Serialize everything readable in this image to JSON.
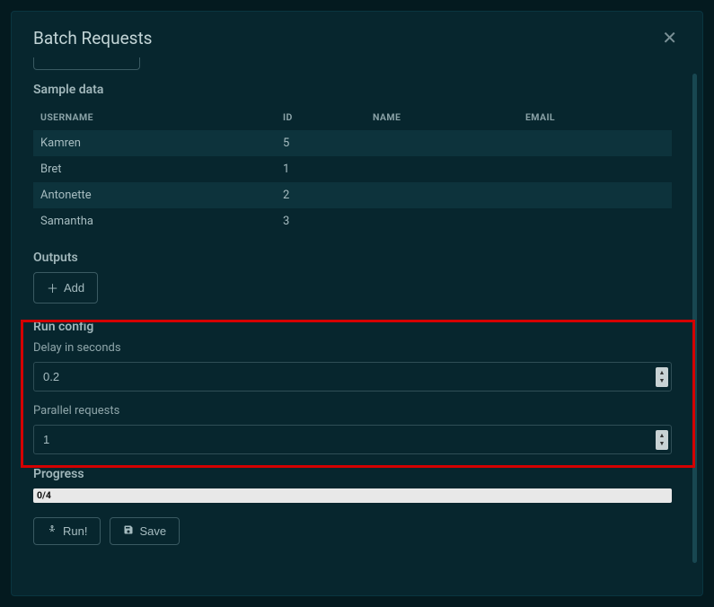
{
  "modal": {
    "title": "Batch Requests"
  },
  "sample": {
    "label": "Sample data",
    "headers": [
      "USERNAME",
      "ID",
      "NAME",
      "EMAIL"
    ],
    "rows": [
      {
        "username": "Kamren",
        "id": "5",
        "name": "",
        "email": ""
      },
      {
        "username": "Bret",
        "id": "1",
        "name": "",
        "email": ""
      },
      {
        "username": "Antonette",
        "id": "2",
        "name": "",
        "email": ""
      },
      {
        "username": "Samantha",
        "id": "3",
        "name": "",
        "email": ""
      }
    ]
  },
  "outputs": {
    "label": "Outputs",
    "add_label": "Add"
  },
  "run_config": {
    "label": "Run config",
    "delay_label": "Delay in seconds",
    "delay_value": "0.2",
    "parallel_label": "Parallel requests",
    "parallel_value": "1"
  },
  "progress": {
    "label": "Progress",
    "text": "0/4"
  },
  "actions": {
    "run_label": "Run!",
    "save_label": "Save"
  }
}
